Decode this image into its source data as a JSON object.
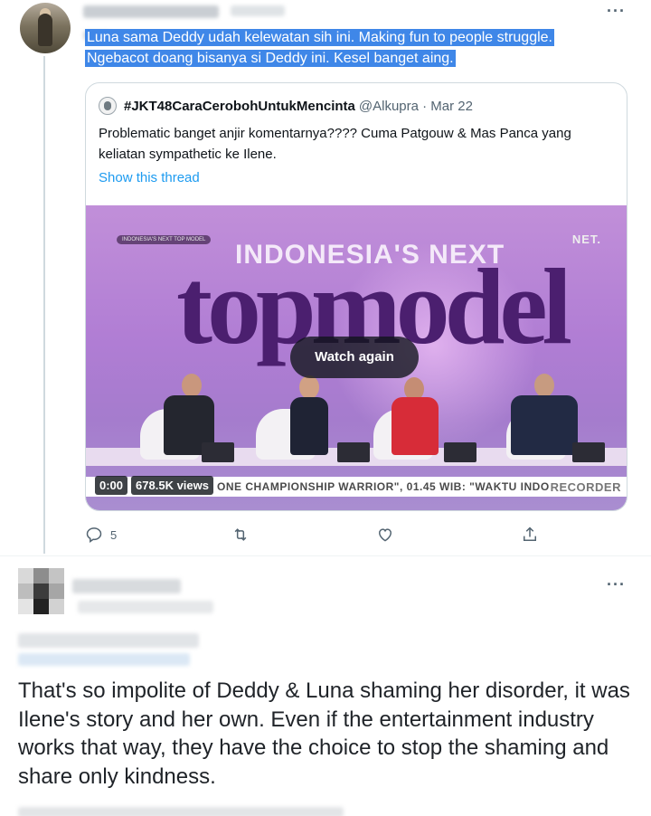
{
  "tweet": {
    "text": "Luna sama Deddy udah kelewatan sih ini. Making fun to people struggle. Ngebacot doang bisanya si Deddy ini. Kesel banget aing.",
    "more_icon": "more-icon"
  },
  "quote": {
    "name": "#JKT48CaraCerobohUntukMencinta",
    "handle": "@Alkupra · Mar 22",
    "body": "Problematic banget anjir komentarnya???? Cuma Patgouw & Mas Panca yang keliatan sympathetic ke Ilene.",
    "show_thread": "Show this thread"
  },
  "video": {
    "badge": "INDONESIA'S NEXT TOP MODEL",
    "title_line1": "INDONESIA'S NEXT",
    "title_line2": "topmodel",
    "network": "NET.",
    "watch_again": "Watch again",
    "time": "0:00",
    "views": "678.5K views",
    "ticker": "ONE CHAMPIONSHIP WARRIOR\", 01.45 WIB: \"WAKTU INDO",
    "recorder": "RECORDER"
  },
  "actions": {
    "reply_count": "5",
    "retweet_count": "",
    "like_count": ""
  },
  "reply": {
    "text": "That's so impolite of Deddy & Luna shaming her disorder, it was Ilene's story and her own. Even if the entertainment industry works that way, they have the choice to stop the shaming and share only kindness."
  },
  "colors": {
    "highlight": "#3f87e8",
    "link": "#1d9bf0",
    "muted": "#536471"
  }
}
